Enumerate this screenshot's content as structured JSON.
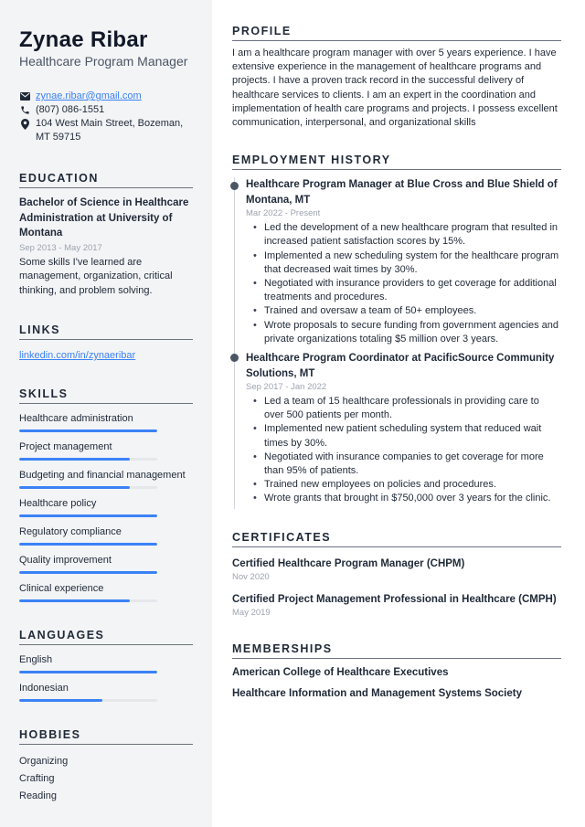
{
  "header": {
    "name": "Zynae Ribar",
    "title": "Healthcare Program Manager"
  },
  "contact": {
    "email": "zynae.ribar@gmail.com",
    "phone": "(807) 086-1551",
    "address": "104 West Main Street, Bozeman, MT 59715",
    "icons": [
      "envelope-icon",
      "phone-icon",
      "map-pin-icon"
    ]
  },
  "education": {
    "title": "EDUCATION",
    "degree": "Bachelor of Science in Healthcare Administration at University of Montana",
    "date": "Sep 2013 - May 2017",
    "description": "Some skills I've learned are management, organization, critical thinking, and problem solving."
  },
  "links": {
    "title": "LINKS",
    "items": [
      "linkedin.com/in/zynaeribar"
    ]
  },
  "skills": {
    "title": "SKILLS",
    "items": [
      {
        "name": "Healthcare administration",
        "level": 1.0
      },
      {
        "name": "Project management",
        "level": 0.8
      },
      {
        "name": "Budgeting and financial management",
        "level": 0.8
      },
      {
        "name": "Healthcare policy",
        "level": 1.0
      },
      {
        "name": "Regulatory compliance",
        "level": 1.0
      },
      {
        "name": "Quality improvement",
        "level": 1.0
      },
      {
        "name": "Clinical experience",
        "level": 0.8
      }
    ]
  },
  "languages": {
    "title": "LANGUAGES",
    "items": [
      {
        "name": "English",
        "level": 1.0
      },
      {
        "name": "Indonesian",
        "level": 0.6
      }
    ]
  },
  "hobbies": {
    "title": "HOBBIES",
    "items": [
      "Organizing",
      "Crafting",
      "Reading"
    ]
  },
  "profile": {
    "title": "PROFILE",
    "text": "I am a healthcare program manager with over 5 years experience. I have extensive experience in the management of healthcare programs and projects. I have a proven track record in the successful delivery of healthcare services to clients. I am an expert in the coordination and implementation of health care programs and projects. I possess excellent communication, interpersonal, and organizational skills"
  },
  "employment": {
    "title": "EMPLOYMENT HISTORY",
    "jobs": [
      {
        "title": "Healthcare Program Manager at Blue Cross and Blue Shield of Montana, MT",
        "date": "Mar 2022 - Present",
        "bullets": [
          "Led the development of a new healthcare program that resulted in increased patient satisfaction scores by 15%.",
          "Implemented a new scheduling system for the healthcare program that decreased wait times by 30%.",
          "Negotiated with insurance providers to get coverage for additional treatments and procedures.",
          "Trained and oversaw a team of 50+ employees.",
          "Wrote proposals to secure funding from government agencies and private organizations totaling $5 million over 3 years."
        ]
      },
      {
        "title": "Healthcare Program Coordinator at PacificSource Community Solutions, MT",
        "date": "Sep 2017 - Jan 2022",
        "bullets": [
          "Led a team of 15 healthcare professionals in providing care to over 500 patients per month.",
          "Implemented new patient scheduling system that reduced wait times by 30%.",
          "Negotiated with insurance companies to get coverage for more than 95% of patients.",
          "Trained new employees on policies and procedures.",
          "Wrote grants that brought in $750,000 over 3 years for the clinic."
        ]
      }
    ]
  },
  "certificates": {
    "title": "CERTIFICATES",
    "items": [
      {
        "name": "Certified Healthcare Program Manager (CHPM)",
        "date": "Nov 2020"
      },
      {
        "name": "Certified Project Management Professional in Healthcare (CMPH)",
        "date": "May 2019"
      }
    ]
  },
  "memberships": {
    "title": "MEMBERSHIPS",
    "items": [
      "American College of Healthcare Executives",
      "Healthcare Information and Management Systems Society"
    ]
  },
  "colors": {
    "accent": "#3b82f6",
    "sidebar_bg": "#f3f4f6",
    "text": "#1f2937",
    "muted": "#9ca3af"
  }
}
